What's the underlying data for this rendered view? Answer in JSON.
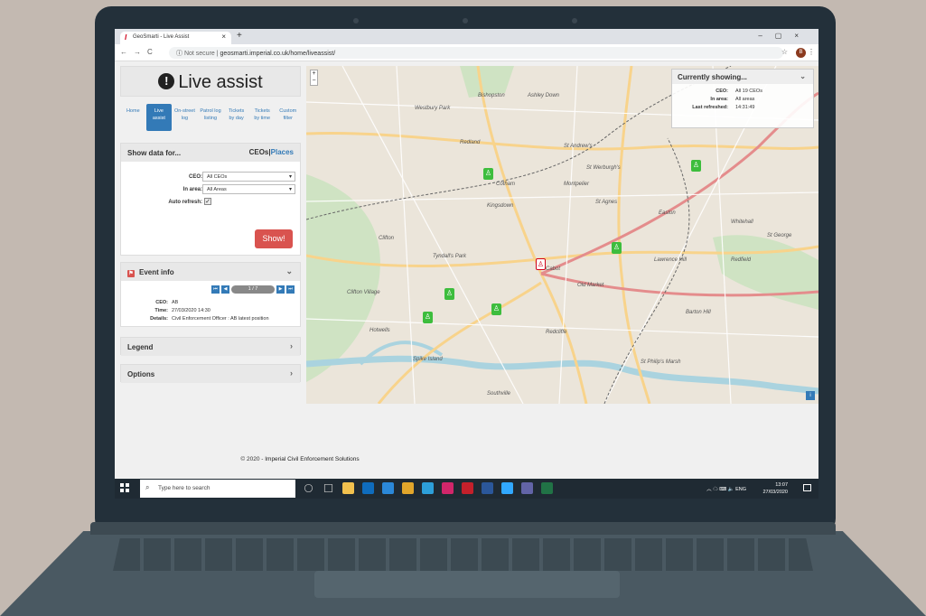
{
  "browser": {
    "tab_title": "GeoSmarti - Live Assist",
    "tab_icon": "I",
    "url_prefix": "Not secure",
    "url": "geosmarti.imperial.co.uk/home/liveassist/",
    "profile_initial": "B"
  },
  "page": {
    "title": "Live assist",
    "nav": [
      {
        "l1": "Home",
        "l2": ""
      },
      {
        "l1": "Live",
        "l2": "assist"
      },
      {
        "l1": "On-street",
        "l2": "log"
      },
      {
        "l1": "Patrol log",
        "l2": "listing"
      },
      {
        "l1": "Tickets",
        "l2": "by day"
      },
      {
        "l1": "Tickets",
        "l2": "by time"
      },
      {
        "l1": "Custom",
        "l2": "filter"
      }
    ],
    "show_data": {
      "header": "Show data for...",
      "toggle_ceos": "CEOs",
      "toggle_sep": "|",
      "toggle_places": "Places",
      "ceo_label": "CEO:",
      "ceo_value": "All CEOs",
      "area_label": "In area:",
      "area_value": "All Areas",
      "refresh_label": "Auto refresh:",
      "refresh_checked": true,
      "show_button": "Show!"
    },
    "event_info": {
      "header": "Event info",
      "pager": "1 / 7",
      "ceo_label": "CEO:",
      "ceo_value": "AB",
      "time_label": "Time:",
      "time_value": "27/03/2020 14:30",
      "details_label": "Details:",
      "details_value": "Civil Enforcement Officer : AB latest position"
    },
    "legend_label": "Legend",
    "options_label": "Options",
    "footer_prefix": "© 2020 - ",
    "footer_brand": "Imperial Civil Enforcement Solutions"
  },
  "map": {
    "showing_title": "Currently showing...",
    "ceo_label": "CEO:",
    "ceo_value": "All 19 CEOs",
    "area_label": "In area:",
    "area_value": "All areas",
    "refreshed_label": "Last refreshed:",
    "refreshed_value": "14:31:49",
    "zoom_in": "+",
    "zoom_out": "−",
    "labels": [
      "Bishopston",
      "Ashley Down",
      "Westbury Park",
      "Redland",
      "St Andrew's",
      "St Werburgh's",
      "Cotham",
      "Montpelier",
      "Kingsdown",
      "St Agnes",
      "Easton",
      "Clifton",
      "Tyndall's Park",
      "Cabot",
      "Old Market",
      "Lawrence Hill",
      "Redfield",
      "Clifton Village",
      "Hotwells",
      "Spike Island",
      "Redcliffe",
      "St Philip's Marsh",
      "Southville",
      "Whitehall",
      "St George",
      "Barton Hill"
    ],
    "pins": [
      {
        "color": "green"
      },
      {
        "color": "green"
      },
      {
        "color": "red"
      },
      {
        "color": "green"
      },
      {
        "color": "green"
      },
      {
        "color": "green"
      },
      {
        "color": "green"
      }
    ]
  },
  "taskbar": {
    "search_placeholder": "Type here to search",
    "time": "13:07",
    "date": "27/03/2020",
    "lang": "ENG",
    "icons": [
      "cortana-icon",
      "task-view-icon",
      "file-explorer-icon",
      "outlook-icon",
      "edge-icon",
      "chrome-icon",
      "app-icon",
      "indesign-icon",
      "acrobat-icon",
      "word-icon",
      "photoshop-icon",
      "teams-icon",
      "excel-icon"
    ],
    "icon_colors": [
      "#1f2a33",
      "#1f2a33",
      "#f2c14e",
      "#0f6cbd",
      "#2b88d8",
      "#e2a62b",
      "#2d9fd9",
      "#d1266a",
      "#c4202b",
      "#2b579a",
      "#31a8ff",
      "#6264a7",
      "#217346"
    ]
  }
}
